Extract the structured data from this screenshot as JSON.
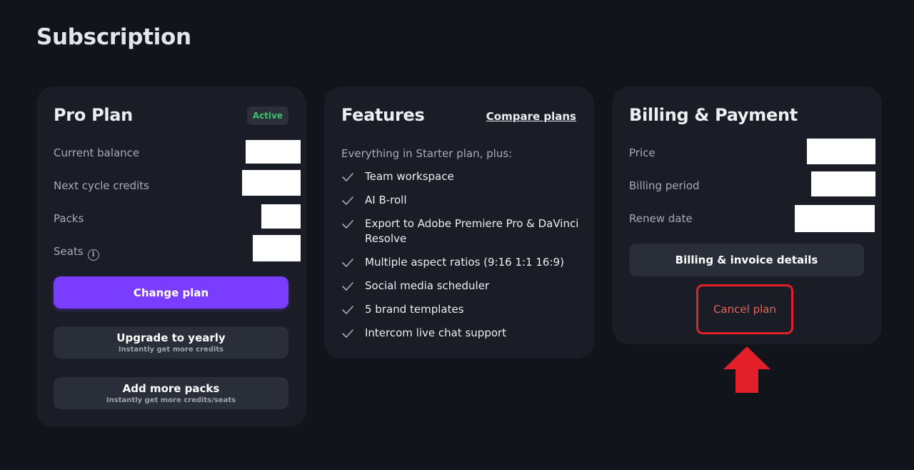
{
  "page": {
    "title": "Subscription"
  },
  "plan_card": {
    "title": "Pro Plan",
    "status_badge": "Active",
    "rows": {
      "current_balance": "Current balance",
      "next_cycle_credits": "Next cycle credits",
      "packs": "Packs",
      "seats": "Seats"
    },
    "info_icon_glyph": "i",
    "change_plan_label": "Change plan",
    "upgrade_label": "Upgrade to yearly",
    "upgrade_sublabel": "Instantly get more credits",
    "add_packs_label": "Add more packs",
    "add_packs_sublabel": "Instantly get more credits/seats"
  },
  "features_card": {
    "title": "Features",
    "compare_link": "Compare plans",
    "intro": "Everything in Starter plan, plus:",
    "items": [
      "Team workspace",
      "AI B-roll",
      "Export to Adobe Premiere Pro & DaVinci Resolve",
      "Multiple aspect ratios (9:16 1:1 16:9)",
      "Social media scheduler",
      "5 brand templates",
      "Intercom live chat support"
    ]
  },
  "billing_card": {
    "title": "Billing & Payment",
    "rows": {
      "price": "Price",
      "billing_period": "Billing period",
      "renew_date": "Renew date"
    },
    "details_button": "Billing & invoice details",
    "cancel_button": "Cancel plan"
  },
  "colors": {
    "background": "#12141b",
    "card": "#1a1d26",
    "primary": "#7a3cff",
    "active_green": "#3ec06b",
    "annotation_red": "#e3202a",
    "cancel_text": "#e4655c"
  },
  "icons": {
    "feature_bullet": "check-icon",
    "seats_info": "info-icon",
    "annotation": "red-up-arrow-icon"
  }
}
